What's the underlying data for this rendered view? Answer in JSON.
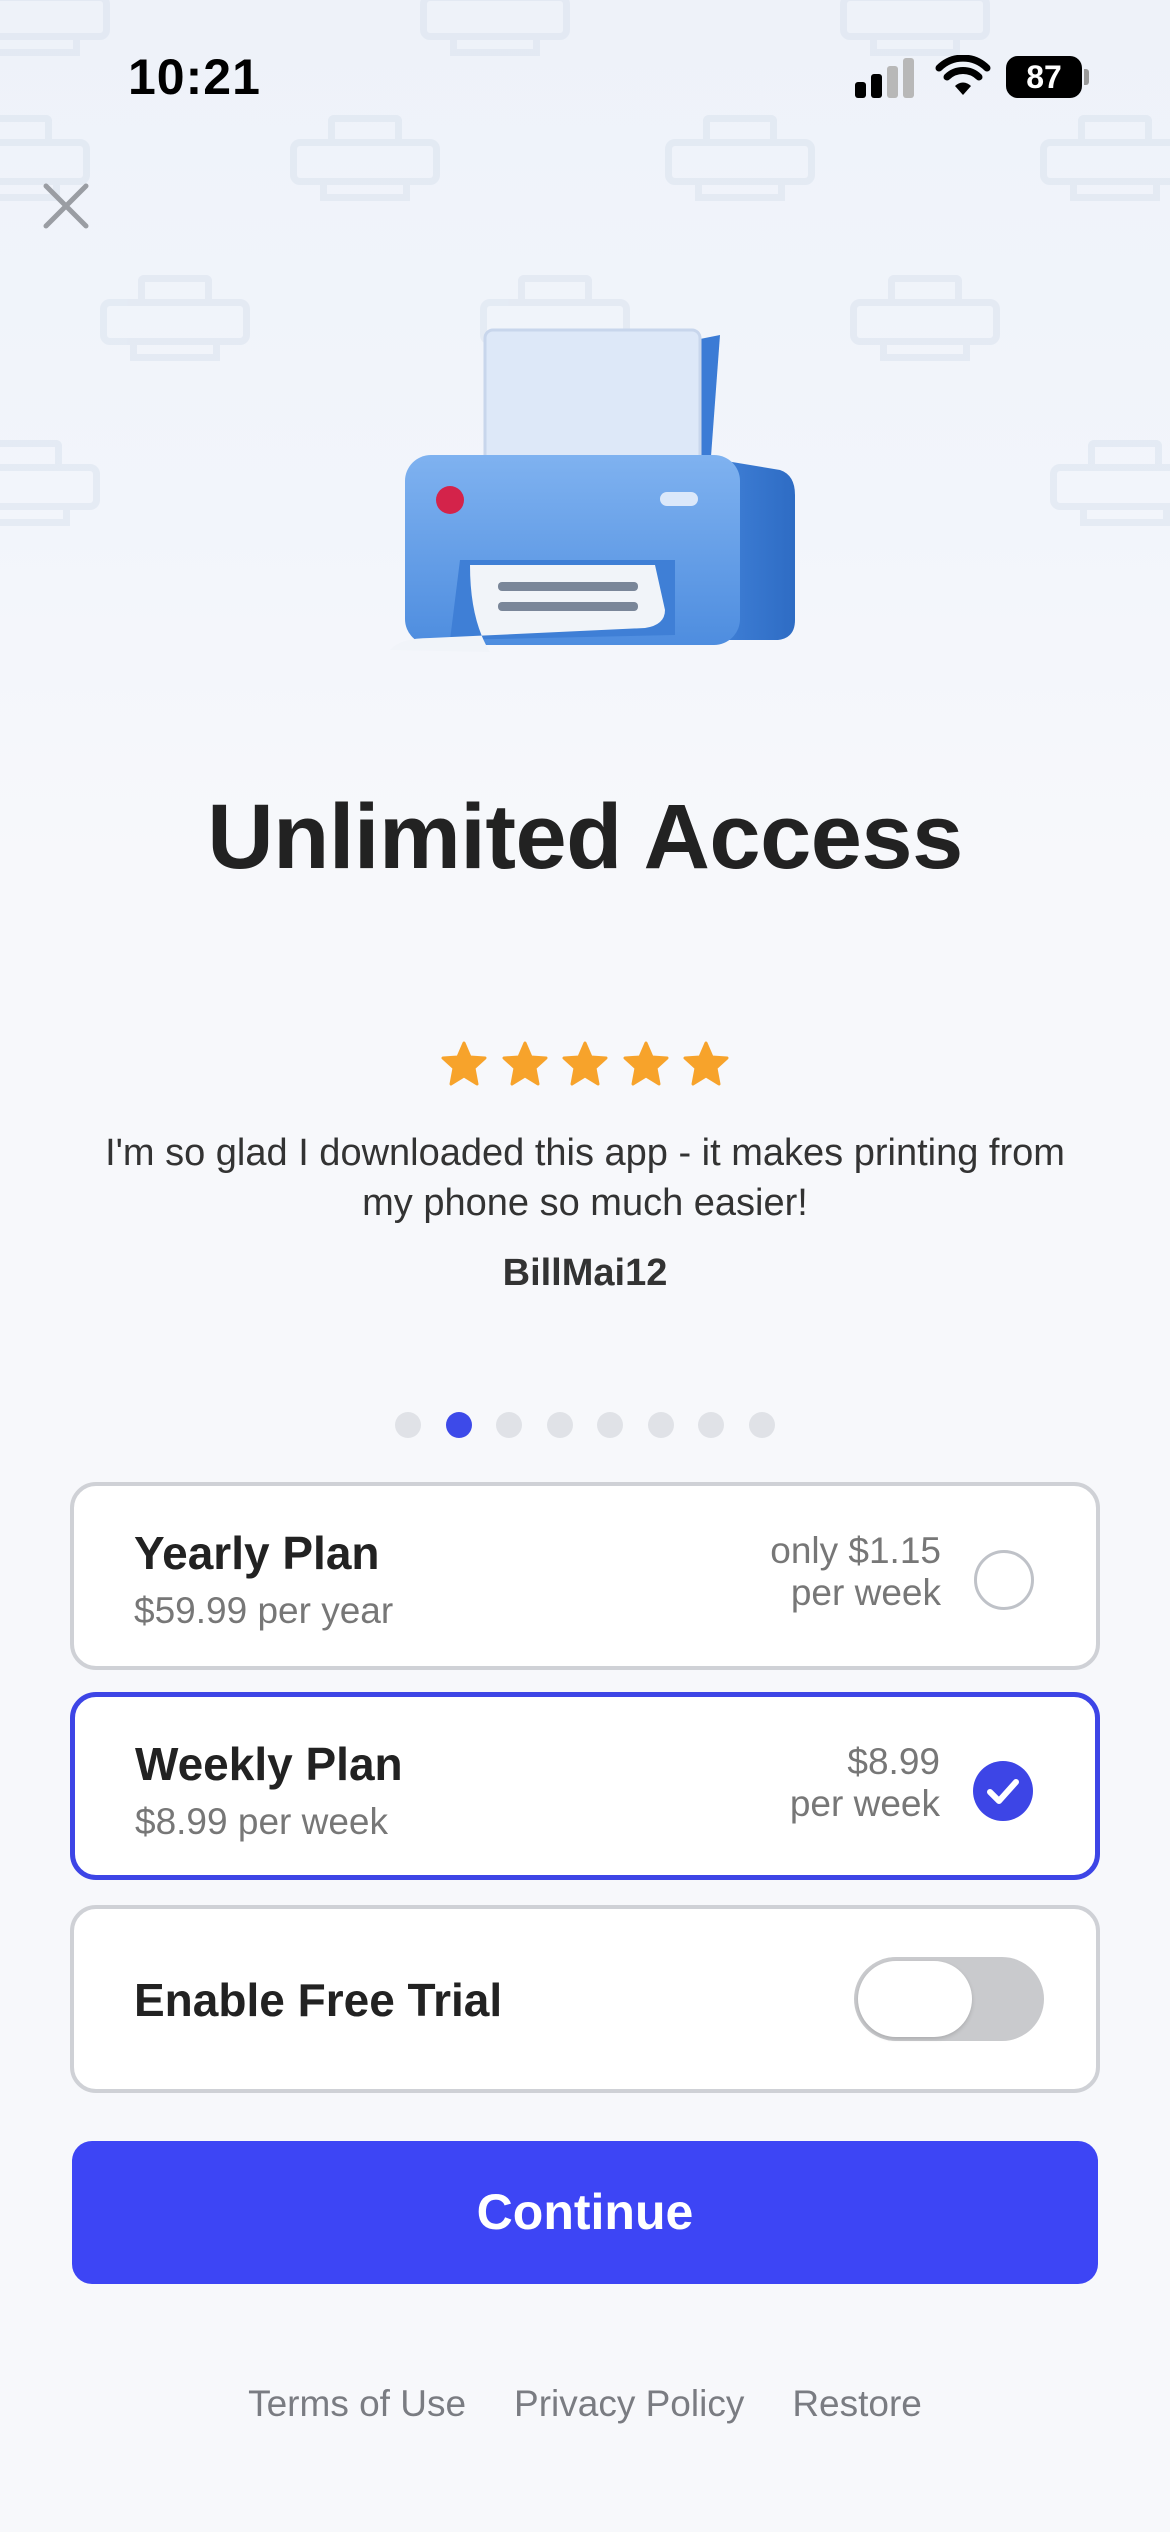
{
  "status_bar": {
    "time": "10:21",
    "battery": "87"
  },
  "hero": {
    "title": "Unlimited Access",
    "illustration": "printer-illustration"
  },
  "review": {
    "rating": 5,
    "text": "I'm so glad I downloaded this app - it makes printing from my phone so much easier!",
    "author": "BillMai12"
  },
  "carousel": {
    "page_count": 8,
    "active_index": 1
  },
  "plans": [
    {
      "name": "Yearly Plan",
      "price": "$59.99 per year",
      "right_line1": "only $1.15",
      "right_line2": "per week",
      "selected": false
    },
    {
      "name": "Weekly Plan",
      "price": "$8.99 per week",
      "right_line1": "$8.99",
      "right_line2": "per week",
      "selected": true
    }
  ],
  "trial": {
    "label": "Enable Free Trial",
    "enabled": false
  },
  "continue_label": "Continue",
  "footer": {
    "terms": "Terms of Use",
    "privacy": "Privacy Policy",
    "restore": "Restore"
  },
  "colors": {
    "accent": "#3d45f5",
    "star": "#f7a32b",
    "printer_blue": "#5b9ae6"
  }
}
